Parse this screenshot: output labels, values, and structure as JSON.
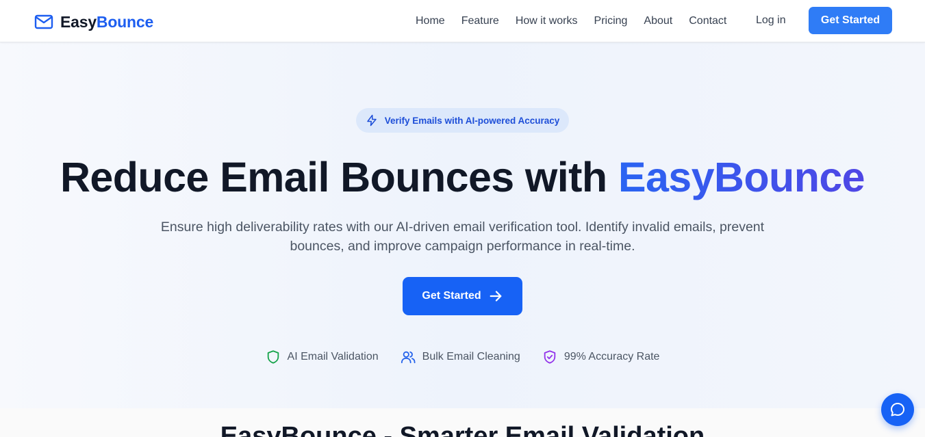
{
  "header": {
    "logo_easy": "Easy",
    "logo_bounce": "Bounce",
    "nav": [
      "Home",
      "Feature",
      "How it works",
      "Pricing",
      "About",
      "Contact"
    ],
    "login": "Log in",
    "cta": "Get Started"
  },
  "hero": {
    "badge": "Verify Emails with AI-powered Accuracy",
    "headline_plain": "Reduce Email Bounces with ",
    "headline_accent": "EasyBounce",
    "subtitle": "Ensure high deliverability rates with our AI-driven email verification tool. Identify invalid emails, prevent bounces, and improve campaign performance in real-time.",
    "cta": "Get Started",
    "features": [
      {
        "icon": "shield-icon",
        "label": "AI Email Validation"
      },
      {
        "icon": "users-icon",
        "label": "Bulk Email Cleaning"
      },
      {
        "icon": "shield-check-icon",
        "label": "99% Accuracy Rate"
      }
    ]
  },
  "section2": {
    "title": "EasyBounce - Smarter Email Validation"
  },
  "colors": {
    "brand": "#1d5ef0",
    "primary_button": "#1762f5",
    "top_button": "#2f7cf6",
    "badge_bg": "#dce8fb",
    "shield_green": "#16a34a",
    "users_blue": "#2563eb",
    "check_purple": "#9333ea"
  }
}
